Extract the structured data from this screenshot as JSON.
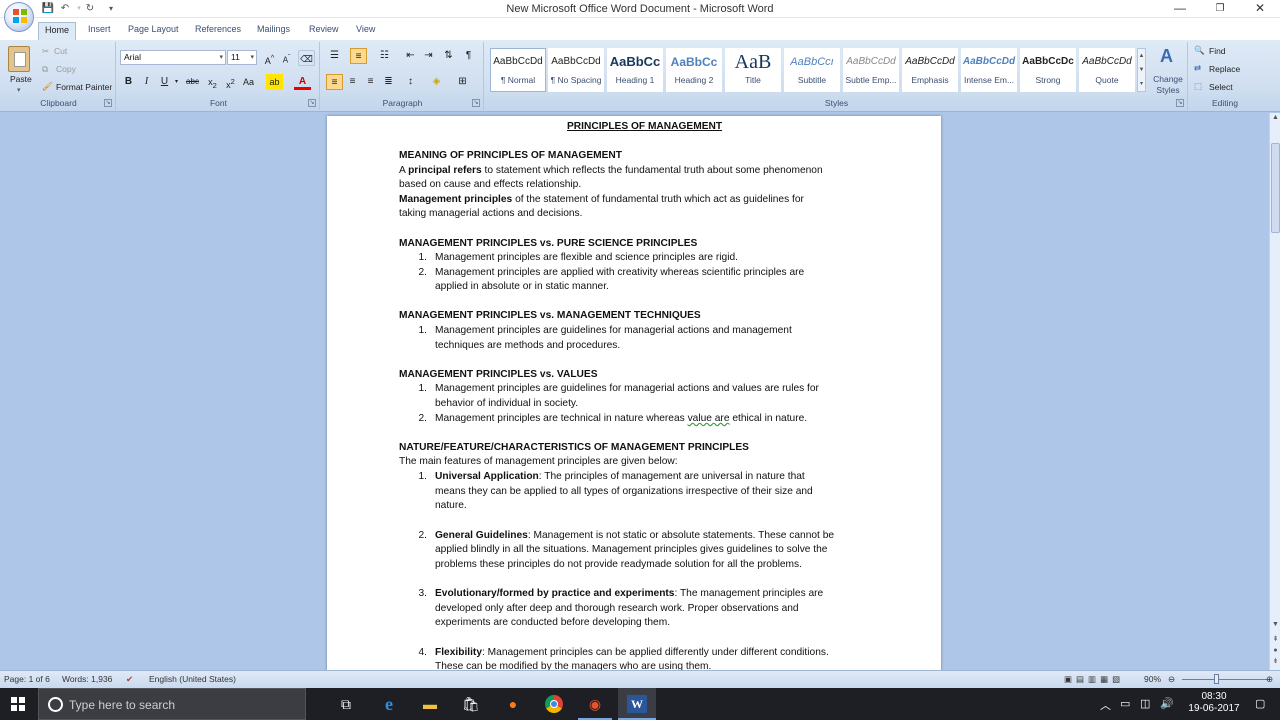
{
  "titlebar": {
    "title": "New Microsoft Office Word Document - Microsoft Word",
    "minimize": "—",
    "maximize": "❐",
    "close": "✕"
  },
  "tabs": [
    "Home",
    "Insert",
    "Page Layout",
    "References",
    "Mailings",
    "Review",
    "View"
  ],
  "ribbon": {
    "clipboard": {
      "paste": "Paste",
      "cut": "Cut",
      "copy": "Copy",
      "format_painter": "Format Painter",
      "label": "Clipboard"
    },
    "font": {
      "family": "Arial",
      "size": "11",
      "label": "Font"
    },
    "paragraph": {
      "label": "Paragraph"
    },
    "styles": {
      "items": [
        {
          "preview": "AaBbCcDd",
          "name": "¶ Normal"
        },
        {
          "preview": "AaBbCcDd",
          "name": "¶ No Spacing"
        },
        {
          "preview": "AaBbCc",
          "name": "Heading 1"
        },
        {
          "preview": "AaBbCc",
          "name": "Heading 2"
        },
        {
          "preview": "AaB",
          "name": "Title"
        },
        {
          "preview": "AaBbCcı",
          "name": "Subtitle"
        },
        {
          "preview": "AaBbCcDd",
          "name": "Subtle Emp..."
        },
        {
          "preview": "AaBbCcDd",
          "name": "Emphasis"
        },
        {
          "preview": "AaBbCcDd",
          "name": "Intense Em..."
        },
        {
          "preview": "AaBbCcDc",
          "name": "Strong"
        },
        {
          "preview": "AaBbCcDd",
          "name": "Quote"
        }
      ],
      "change_styles": "Change Styles",
      "label": "Styles"
    },
    "editing": {
      "find": "Find",
      "replace": "Replace",
      "select": "Select",
      "label": "Editing"
    }
  },
  "document": {
    "title": "PRINCIPLES OF MANAGEMENT",
    "s1_head": "MEANING OF PRINCIPLES OF MANAGEMENT",
    "s1_p1_bold": "principal refers",
    "s1_p1_a": "A ",
    "s1_p1_b": " to statement which reflects the fundamental truth about some phenomenon",
    "s1_p1_c": "based on cause and effects relationship.",
    "s1_p2_bold": "Management principles",
    "s1_p2_b": " of the statement of fundamental truth which act as guidelines for",
    "s1_p2_c": "taking managerial actions and decisions.",
    "s2_head": "MANAGEMENT PRINCIPLES vs. PURE SCIENCE PRINCIPLES",
    "s2_i1": "Management principles are flexible and science principles are rigid.",
    "s2_i2a": " Management principles are applied with creativity whereas scientific principles are",
    "s2_i2b": "applied in absolute or in static manner.",
    "s3_head": "MANAGEMENT PRINCIPLES vs. MANAGEMENT TECHNIQUES",
    "s3_i1a": "Management principles are guidelines for managerial actions and management",
    "s3_i1b": "techniques are methods and procedures.",
    "s4_head": "MANAGEMENT PRINCIPLES vs. VALUES",
    "s4_i1a": "Management principles are guidelines for managerial actions and values are rules for",
    "s4_i1b": "behavior of individual in society.",
    "s4_i2a": "Management principles are technical in nature whereas ",
    "s4_i2u": "value are",
    "s4_i2b": " ethical in nature.",
    "s5_head": "NATURE/FEATURE/CHARACTERISTICS OF MANAGEMENT PRINCIPLES",
    "s5_intro": "The main features of management principles are given below:",
    "f1_bold": "Universal Application",
    "f1a": ": The principles of management are universal in nature that",
    "f1b": "means they can be applied to all types of organizations irrespective of their size and",
    "f1c": "nature.",
    "f2_bold": "General Guidelines",
    "f2a": ": Management is not static or absolute statements. These cannot be",
    "f2b": "applied blindly in all the situations. Management principles gives guidelines to solve the",
    "f2c": "problems these principles do not provide readymade solution for all the problems.",
    "f3_bold": "Evolutionary/formed by practice and experiments",
    "f3a": ": The management principles are",
    "f3b": "developed only after deep and thorough research work. Proper observations and",
    "f3c": "experiments are conducted before developing them.",
    "f4_bold": "Flexibility",
    "f4a": ": Management principles can be applied differently under different conditions.",
    "f4b": "These can be modified by the managers who are using them.",
    "n1": "1.",
    "n2": "2.",
    "n3": "3.",
    "n4": "4."
  },
  "statusbar": {
    "page": "Page: 1 of 6",
    "words": "Words: 1,936",
    "language": "English (United States)",
    "zoom": "90%"
  },
  "taskbar": {
    "search_placeholder": "Type here to search",
    "time": "08:30",
    "date": "19-06-2017"
  }
}
